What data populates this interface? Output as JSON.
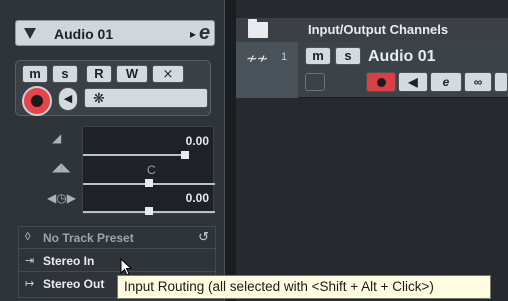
{
  "inspector": {
    "track_name": "Audio 01",
    "arrow": "▸",
    "edit_glyph": "e",
    "buttons": {
      "m": "m",
      "s": "s",
      "r": "R",
      "w": "W",
      "x": "⨯"
    },
    "fader_volume_value": "0.00",
    "pan_center": "C",
    "delay_value": "0.00",
    "presets": {
      "no_preset_label": "No Track Preset",
      "input_label": "Stereo In",
      "output_label": "Stereo Out"
    }
  },
  "track_list": {
    "header_title": "Input/Output Channels",
    "track": {
      "number": "1",
      "name": "Audio 01",
      "m": "m",
      "s": "s",
      "edit_glyph": "e"
    }
  },
  "tooltip": {
    "text": "Input Routing (all selected with <Shift + Alt + Click>)"
  },
  "colors": {
    "record_red": "#e4444a",
    "panel_bg": "#2f3439",
    "button_face": "#d4dbe0",
    "tooltip_bg": "#fffce0"
  }
}
